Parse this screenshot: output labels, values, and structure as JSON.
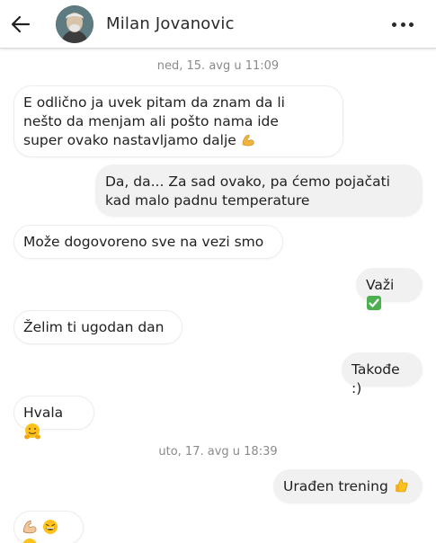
{
  "header": {
    "contact_name": "Milan Jovanovic",
    "back_icon": "arrow-left-icon",
    "menu_icon": "more-horizontal-icon"
  },
  "timestamps": [
    "ned, 15. avg u 11:09",
    "uto, 17. avg u 18:39"
  ],
  "messages": [
    {
      "direction": "in",
      "lines": [
        "E odlično ja uvek pitam da znam da li",
        "nešto da menjam ali pošto nama ide",
        "super ovako nastavljamo dalje"
      ],
      "emoji": "flexed-biceps"
    },
    {
      "direction": "out",
      "lines": [
        "Da, da... Za sad ovako, pa ćemo pojačati",
        "kad malo padnu temperature"
      ]
    },
    {
      "direction": "in",
      "text": "Može dogovoreno sve na vezi smo"
    },
    {
      "direction": "out",
      "text": "Važi",
      "emoji": "check-mark-button"
    },
    {
      "direction": "in",
      "text": "Želim ti ugodan dan"
    },
    {
      "direction": "out",
      "text": "Takođe :)"
    },
    {
      "direction": "in",
      "text": "Hvala",
      "emoji": "hugging-face"
    },
    {
      "direction": "out",
      "text": "Urađen trening",
      "emoji": "thumbs-up"
    },
    {
      "direction": "in",
      "text": "",
      "emoji": "flexed-biceps grinning-sweat grinning-sweat"
    }
  ],
  "colors": {
    "incoming_bubble": "#ffffff",
    "outgoing_bubble": "#f1f1f1",
    "timestamp": "#8a8a8a"
  }
}
